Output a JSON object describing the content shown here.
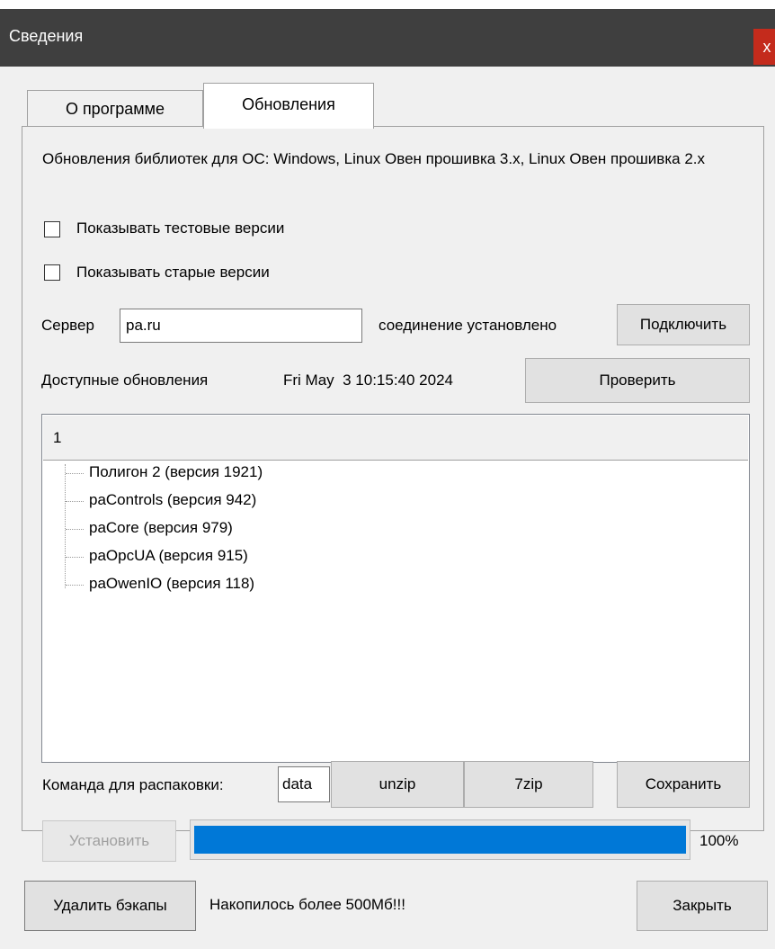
{
  "window": {
    "title": "Сведения",
    "close_label": "x",
    "colors": {
      "titlebar": "#3f3f3f",
      "close": "#c42b1c",
      "progress": "#0078d7"
    }
  },
  "tabs": [
    {
      "label": "О программе",
      "active": false
    },
    {
      "label": "Обновления",
      "active": true
    }
  ],
  "description": "Обновления библиотек для ОС: Windows, Linux Овен прошивка 3.x, Linux Овен прошивка 2.x",
  "options": {
    "show_test": {
      "label": "Показывать тестовые версии",
      "checked": false
    },
    "show_old": {
      "label": "Показывать старые версии",
      "checked": false
    }
  },
  "server": {
    "label": "Сервер",
    "value": "pa.ru",
    "status": "соединение установлено",
    "connect_label": "Подключить"
  },
  "updates": {
    "label": "Доступные обновления",
    "timestamp": "Fri May  3 10:15:40 2024",
    "check_label": "Проверить"
  },
  "list": {
    "header": "1",
    "items": [
      "Полигон 2 (версия 1921)",
      "paControls (версия 942)",
      "paCore (версия 979)",
      "paOpcUA (версия 915)",
      "paOwenIO (версия 118)"
    ]
  },
  "unpack": {
    "label": "Команда для распаковки:",
    "value": "data",
    "unzip_label": "unzip",
    "zip7_label": "7zip",
    "save_label": "Сохранить"
  },
  "install": {
    "label": "Установить",
    "progress": 100,
    "progress_text": "100%"
  },
  "footer": {
    "delete_backups_label": "Удалить бэкапы",
    "warning": "Накопилось более 500Мб!!!",
    "close_label": "Закрыть"
  }
}
